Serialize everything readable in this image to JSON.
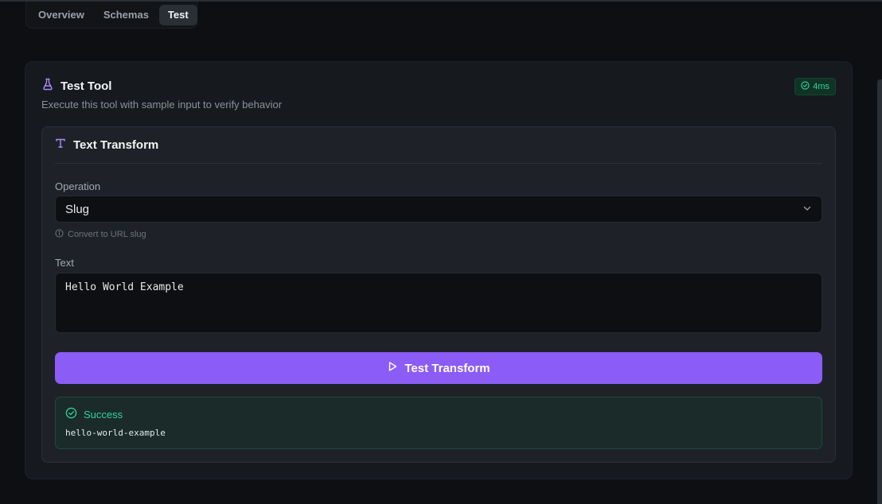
{
  "tabs": [
    {
      "label": "Overview",
      "active": false
    },
    {
      "label": "Schemas",
      "active": false
    },
    {
      "label": "Test",
      "active": true
    }
  ],
  "card": {
    "title": "Test Tool",
    "subtitle": "Execute this tool with sample input to verify behavior",
    "timing": "4ms",
    "icon": "flask-icon"
  },
  "tool": {
    "title": "Text Transform",
    "icon": "text-type-icon",
    "operation_label": "Operation",
    "operation_value": "Slug",
    "operation_hint": "Convert to URL slug",
    "text_label": "Text",
    "text_value": "Hello World Example",
    "run_label": "Test Transform"
  },
  "result": {
    "status": "Success",
    "output": "hello-world-example"
  },
  "colors": {
    "accent": "#8b5cf6",
    "success": "#34d399",
    "background": "#0d0f12"
  }
}
